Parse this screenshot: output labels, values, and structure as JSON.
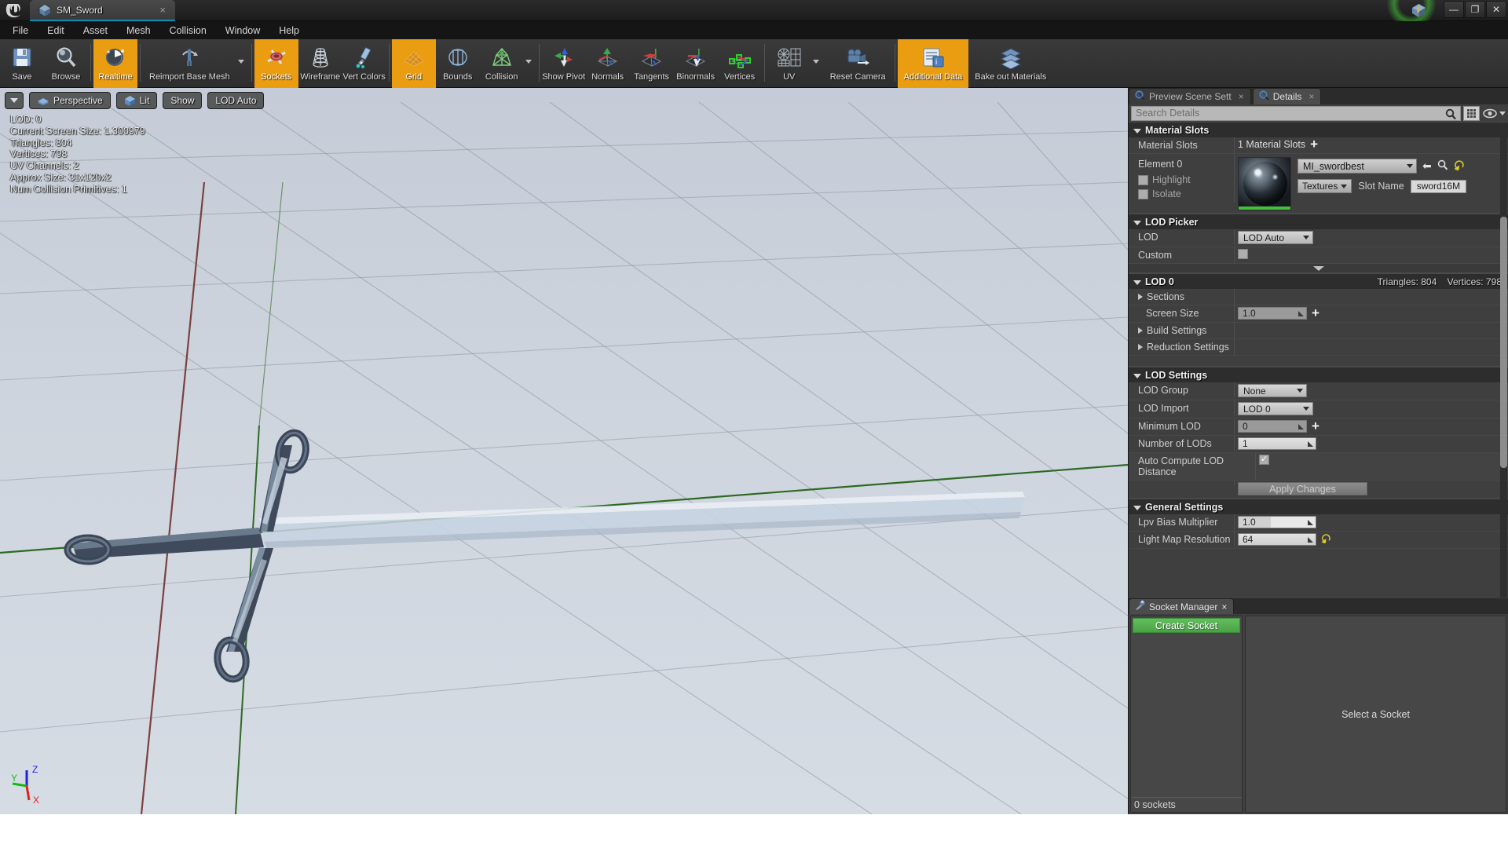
{
  "titlebar": {
    "logo": "ue-logo",
    "asset_tab_label": "SM_Sword",
    "asset_tab_close": "×",
    "minimize": "—",
    "restore": "❐",
    "close": "✕"
  },
  "menubar": {
    "items": [
      {
        "label": "File"
      },
      {
        "label": "Edit"
      },
      {
        "label": "Asset"
      },
      {
        "label": "Mesh"
      },
      {
        "label": "Collision"
      },
      {
        "label": "Window"
      },
      {
        "label": "Help"
      }
    ]
  },
  "toolbar": {
    "buttons": [
      {
        "label": "Save",
        "icon": "save-icon",
        "active": false,
        "dropdown": false,
        "wide": false
      },
      {
        "label": "Browse",
        "icon": "browse-magnifier-icon",
        "active": false,
        "dropdown": false,
        "wide": false
      },
      {
        "label": "Realtime",
        "icon": "realtime-clock-icon",
        "active": true,
        "dropdown": false,
        "wide": false
      },
      {
        "label": "Reimport Base Mesh",
        "icon": "reimport-mesh-icon",
        "active": false,
        "dropdown": true,
        "wide": true
      },
      {
        "label": "Sockets",
        "icon": "sockets-icon",
        "active": true,
        "dropdown": false,
        "wide": false
      },
      {
        "label": "Wireframe",
        "icon": "wireframe-icon",
        "active": false,
        "dropdown": false,
        "wide": false
      },
      {
        "label": "Vert Colors",
        "icon": "vert-colors-icon",
        "active": false,
        "dropdown": false,
        "wide": false
      },
      {
        "label": "Grid",
        "icon": "grid-icon",
        "active": true,
        "dropdown": false,
        "wide": false
      },
      {
        "label": "Bounds",
        "icon": "bounds-icon",
        "active": false,
        "dropdown": false,
        "wide": false
      },
      {
        "label": "Collision",
        "icon": "collision-icon",
        "active": false,
        "dropdown": true,
        "wide": false
      },
      {
        "label": "Show Pivot",
        "icon": "show-pivot-icon",
        "active": false,
        "dropdown": false,
        "wide": false
      },
      {
        "label": "Normals",
        "icon": "normals-icon",
        "active": false,
        "dropdown": false,
        "wide": false
      },
      {
        "label": "Tangents",
        "icon": "tangents-icon",
        "active": false,
        "dropdown": false,
        "wide": false
      },
      {
        "label": "Binormals",
        "icon": "binormals-icon",
        "active": false,
        "dropdown": false,
        "wide": false
      },
      {
        "label": "Vertices",
        "icon": "vertices-icon",
        "active": false,
        "dropdown": false,
        "wide": false
      },
      {
        "label": "UV",
        "icon": "uv-icon",
        "active": false,
        "dropdown": true,
        "wide": false
      },
      {
        "label": "Reset Camera",
        "icon": "reset-camera-icon",
        "active": false,
        "dropdown": false,
        "wide": true
      },
      {
        "label": "Additional Data",
        "icon": "additional-data-icon",
        "active": true,
        "dropdown": false,
        "wide": true
      },
      {
        "label": "Bake out Materials",
        "icon": "bake-materials-icon",
        "active": false,
        "dropdown": false,
        "wide": true
      }
    ]
  },
  "viewport": {
    "controls": [
      {
        "name": "viewport-options-dropdown",
        "label": ""
      },
      {
        "name": "view-mode-perspective",
        "label": "Perspective"
      },
      {
        "name": "view-mode-lit",
        "label": "Lit"
      },
      {
        "name": "show-menu",
        "label": "Show"
      },
      {
        "name": "lod-menu",
        "label": "LOD Auto"
      }
    ],
    "stats": [
      "LOD:  0",
      "Current Screen Size:  1.300979",
      "Triangles:  804",
      "Vertices:  798",
      "UV Channels:  2",
      "Approx Size: 31x120x2",
      "Num Collision Primitives:  1"
    ],
    "gizmo_axes": [
      {
        "label": "Z",
        "color": "#2222dd"
      },
      {
        "label": "Y",
        "color": "#11bb11"
      },
      {
        "label": "X",
        "color": "#dd2222"
      }
    ]
  },
  "details_panel": {
    "tabs": [
      {
        "label": "Preview Scene Sett",
        "icon": "preview-scene-icon",
        "active": false
      },
      {
        "label": "Details",
        "icon": "details-icon",
        "active": true
      }
    ],
    "search_placeholder": "Search Details",
    "search_value": "",
    "material_slots": {
      "header": "Material Slots",
      "row_label": "Material Slots",
      "count_text": "1 Material Slots",
      "add_label": "+",
      "element_label": "Element 0",
      "highlight_label": "Highlight",
      "highlight_checked": false,
      "isolate_label": "Isolate",
      "isolate_checked": false,
      "material_name": "MI_swordbest",
      "textures_label": "Textures",
      "slot_name_label": "Slot Name",
      "slot_name_value": "sword16M"
    },
    "lod_picker": {
      "header": "LOD Picker",
      "lod_label": "LOD",
      "lod_value": "LOD Auto",
      "custom_label": "Custom",
      "custom_checked": false
    },
    "lod0": {
      "header": "LOD 0",
      "triangles": "Triangles: 804",
      "vertices": "Vertices: 798",
      "sections_label": "Sections",
      "screen_size_label": "Screen Size",
      "screen_size_value": "1.0",
      "build_settings_label": "Build Settings",
      "reduction_settings_label": "Reduction Settings"
    },
    "lod_settings": {
      "header": "LOD Settings",
      "lod_group_label": "LOD Group",
      "lod_group_value": "None",
      "lod_import_label": "LOD Import",
      "lod_import_value": "LOD 0",
      "minimum_lod_label": "Minimum LOD",
      "minimum_lod_value": "0",
      "number_of_lods_label": "Number of LODs",
      "number_of_lods_value": "1",
      "auto_compute_label": "Auto Compute LOD Distance",
      "auto_compute_checked": true,
      "apply_changes_label": "Apply Changes"
    },
    "general_settings": {
      "header": "General Settings",
      "lpv_bias_label": "Lpv Bias Multiplier",
      "lpv_bias_value": "1.0",
      "light_map_label": "Light Map Resolution",
      "light_map_value": "64"
    }
  },
  "socket_manager": {
    "tab_label": "Socket Manager",
    "tab_icon": "socket-wrench-icon",
    "create_button": "Create Socket",
    "empty_message": "Select a Socket",
    "count_text": "0 sockets",
    "sockets": []
  },
  "colors": {
    "accent_orange": "#eb9d12",
    "green_button": "#4aa246",
    "tab_underline": "#0e8fb3",
    "panel_bg": "#3f3f3f",
    "category_bg": "#2d2d2d"
  }
}
